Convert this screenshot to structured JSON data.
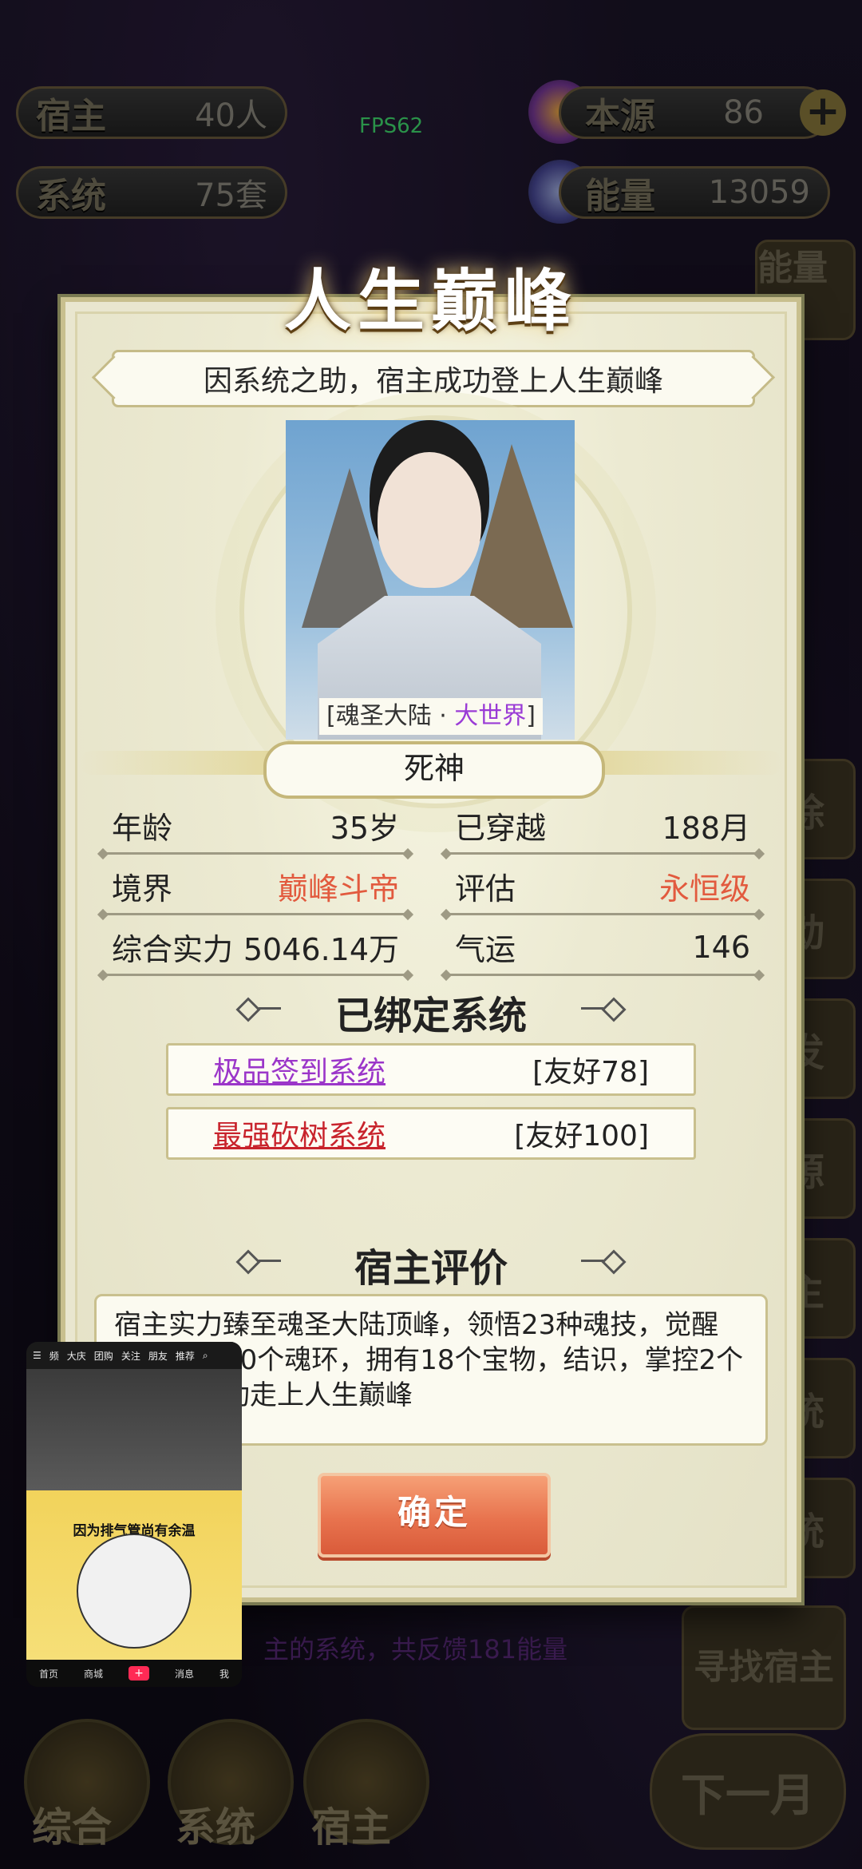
{
  "hud": {
    "host_label": "宿主",
    "host_value": "40人",
    "system_label": "系统",
    "system_value": "75套",
    "source_label": "本源",
    "source_value": "86",
    "energy_label": "能量",
    "energy_value": "13059",
    "fps": "FPS62"
  },
  "side_buttons": [
    "能量包",
    "除",
    "动",
    "发",
    "源",
    "主",
    "统",
    "统"
  ],
  "bottom_nav": {
    "items": [
      "综合",
      "系统",
      "宿主"
    ],
    "next_month": "下一月",
    "find_host": "寻找宿主"
  },
  "feed_text": "主的系统，共反馈181能量",
  "modal": {
    "title": "人生巅峰",
    "subtitle": "因系统之助，宿主成功登上人生巅峰",
    "world_left": "[魂圣大陆 · ",
    "world_right": "大世界",
    "world_end": "]",
    "name": "死神",
    "stats": {
      "age_label": "年龄",
      "age_value": "35岁",
      "traveled_label": "已穿越",
      "traveled_value": "188月",
      "realm_label": "境界",
      "realm_value": "巅峰斗帝",
      "rating_label": "评估",
      "rating_value": "永恒级",
      "power_label": "综合实力",
      "power_value": "5046.14万",
      "luck_label": "气运",
      "luck_value": "146"
    },
    "bound_title": "已绑定系统",
    "systems": [
      {
        "name": "极品签到系统",
        "favor": "[友好78]",
        "color": "#9b36c9"
      },
      {
        "name": "最强砍树系统",
        "favor": "[友好100]",
        "color": "#c8232c"
      }
    ],
    "eval_title": "宿主评价",
    "eval_text": "宿主实力臻至魂圣大陆顶峰，领悟23种魂技，觉醒魂，吸收20个魂环，拥有18个宝物，结识，掌控2个势力，成功走上人生巅峰",
    "confirm": "确定"
  },
  "pip": {
    "tabs": [
      "频",
      "大庆",
      "团购",
      "关注",
      "朋友",
      "推荐"
    ],
    "caption": "因为排气管尚有余温",
    "bottom": [
      "首页",
      "商城",
      "+",
      "消息",
      "我"
    ]
  }
}
